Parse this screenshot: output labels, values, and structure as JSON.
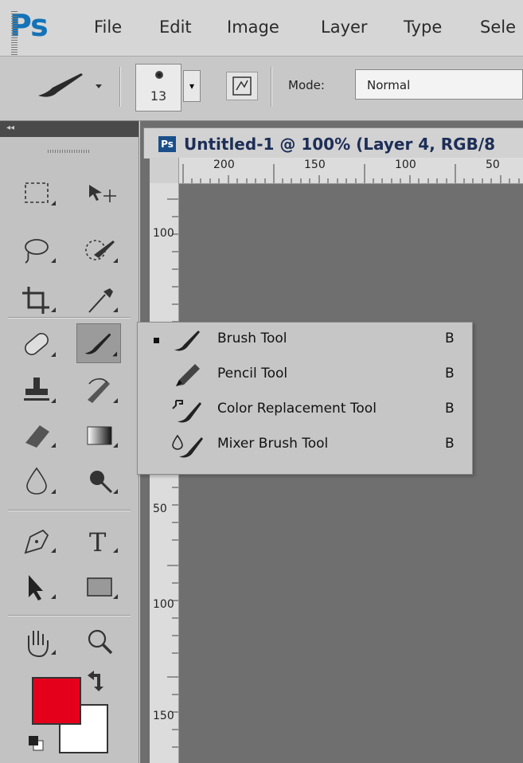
{
  "app": {
    "logo": "Ps"
  },
  "menubar": {
    "items": [
      "File",
      "Edit",
      "Image",
      "Layer",
      "Type",
      "Sele"
    ]
  },
  "options_bar": {
    "brush_size": "13",
    "mode_label": "Mode:",
    "mode_value": "Normal"
  },
  "document": {
    "tab_badge": "Ps",
    "tab_title": "Untitled-1 @ 100% (Layer 4, RGB/8",
    "ruler_top": [
      "200",
      "150",
      "100",
      "50"
    ],
    "ruler_left": [
      "100",
      "50",
      "100",
      "150"
    ]
  },
  "flyout": {
    "items": [
      {
        "label": "Brush Tool",
        "shortcut": "B",
        "icon": "brush-icon",
        "selected": true
      },
      {
        "label": "Pencil Tool",
        "shortcut": "B",
        "icon": "pencil-icon",
        "selected": false
      },
      {
        "label": "Color Replacement Tool",
        "shortcut": "B",
        "icon": "color-replacement-icon",
        "selected": false
      },
      {
        "label": "Mixer Brush Tool",
        "shortcut": "B",
        "icon": "mixer-brush-icon",
        "selected": false
      }
    ]
  },
  "colors": {
    "foreground": "#e4001b",
    "background": "#ffffff",
    "canvas": "#6f6f6f",
    "accent": "#1473b8"
  }
}
